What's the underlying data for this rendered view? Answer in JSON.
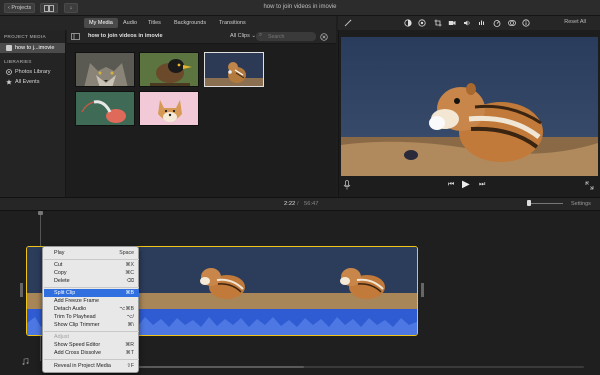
{
  "titlebar": {
    "projects_label": "Projects",
    "title": "how to join videos in imovie"
  },
  "browser_tabs": [
    "My Media",
    "Audio",
    "Titles",
    "Backgrounds",
    "Transitions"
  ],
  "sidebar": {
    "project_media_header": "PROJECT MEDIA",
    "project_item": "how to j...imovie",
    "libraries_header": "LIBRARIES",
    "library_items": [
      "Photos Library",
      "All Events"
    ]
  },
  "browser": {
    "event_title": "how to join videos in imovie",
    "clips_filter": "All Clips",
    "search_placeholder": "Search",
    "thumbnails": [
      "wolf",
      "bird",
      "chipmunk",
      "ibis",
      "dog"
    ]
  },
  "viewer": {
    "reset_all": "Reset All"
  },
  "timeline": {
    "current_time": "2:22",
    "total_time": "56:47",
    "settings_label": "Settings"
  },
  "context_menu": {
    "items": [
      {
        "label": "Play",
        "shortcut": "Space"
      },
      {
        "label": "Cut",
        "shortcut": "⌘X"
      },
      {
        "label": "Copy",
        "shortcut": "⌘C"
      },
      {
        "label": "Delete",
        "shortcut": "⌫"
      },
      {
        "label": "Split Clip",
        "shortcut": "⌘B"
      },
      {
        "label": "Add Freeze Frame",
        "shortcut": ""
      },
      {
        "label": "Detach Audio",
        "shortcut": "⌥⌘B"
      },
      {
        "label": "Trim To Playhead",
        "shortcut": "⌥/"
      },
      {
        "label": "Show Clip Trimmer",
        "shortcut": "⌘\\"
      },
      {
        "label": "Adjust",
        "shortcut": ""
      },
      {
        "label": "Show Speed Editor",
        "shortcut": "⌘R"
      },
      {
        "label": "Add Cross Dissolve",
        "shortcut": "⌘T"
      },
      {
        "label": "Reveal in Project Media",
        "shortcut": "⇧F"
      }
    ],
    "highlighted_index": 4,
    "disabled_index": 9
  },
  "colors": {
    "accent": "#2f6fe0",
    "clip_border": "#f0c419",
    "audio_wave": "#2f5bd3"
  }
}
